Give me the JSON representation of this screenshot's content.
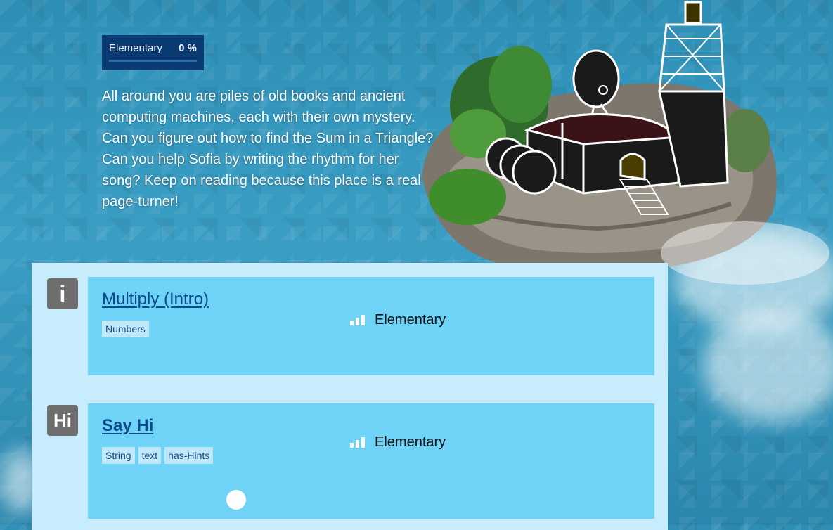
{
  "progress": {
    "level_label": "Elementary",
    "percent_label": "0 %",
    "fraction": 0
  },
  "intro_text": "All around you are piles of old books and ancient computing machines, each with their own mystery. Can you figure out how to find the Sum in a Triangle? Can you help Sofia by writing the rhythm for her song? Keep on reading because this place is a real page-turner!",
  "missions": [
    {
      "icon_text": "i",
      "title": "Multiply (Intro)",
      "tags": [
        "Numbers"
      ],
      "difficulty": "Elementary"
    },
    {
      "icon_text": "Hi",
      "title": "Say Hi",
      "tags": [
        "String",
        "text",
        "has-Hints"
      ],
      "difficulty": "Elementary"
    }
  ],
  "colors": {
    "progress_bg": "#0b3b73",
    "panel_bg": "#c7ecfb",
    "card_bg": "#6fd2f7",
    "link": "#0b4a8a",
    "tag_bg": "#bfe8fb",
    "icon_bg": "#6e6e6e"
  }
}
